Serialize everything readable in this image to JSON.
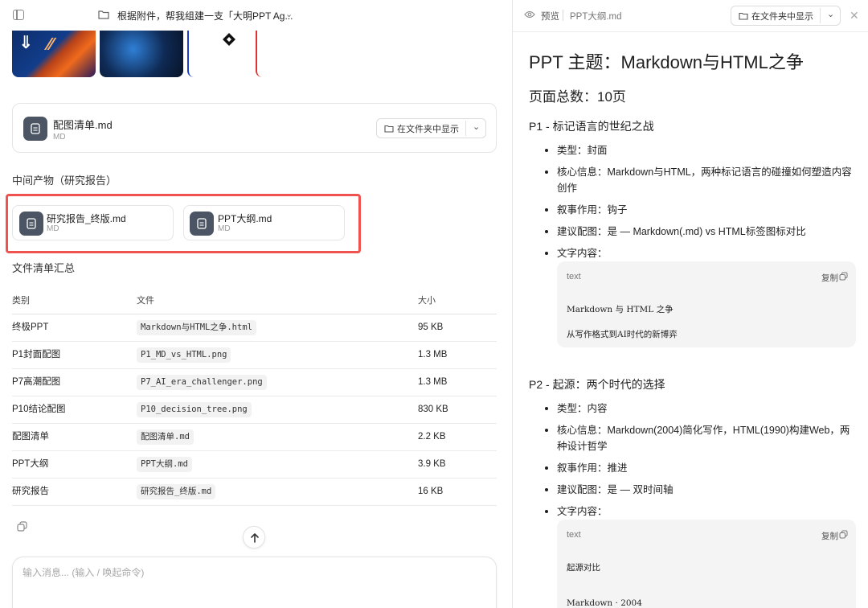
{
  "conversation": {
    "title": "根据附件，帮我组建一支「大明PPT Ag..."
  },
  "left": {
    "config_card": {
      "name": "配图清单.md",
      "ext": "MD",
      "show_in_folder": "在文件夹中显示"
    },
    "intermediate_heading": "中间产物（研究报告）",
    "intermediate_files": [
      {
        "name": "研究报告_终版.md",
        "ext": "MD"
      },
      {
        "name": "PPT大纲.md",
        "ext": "MD"
      }
    ],
    "summary_heading": "文件清单汇总",
    "table": {
      "headers": [
        "类别",
        "文件",
        "大小"
      ],
      "rows": [
        {
          "category": "终极PPT",
          "file": "Markdown与HTML之争.html",
          "size": "95 KB"
        },
        {
          "category": "P1封面配图",
          "file": "P1_MD_vs_HTML.png",
          "size": "1.3 MB"
        },
        {
          "category": "P7高潮配图",
          "file": "P7_AI_era_challenger.png",
          "size": "1.3 MB"
        },
        {
          "category": "P10结论配图",
          "file": "P10_decision_tree.png",
          "size": "830 KB"
        },
        {
          "category": "配图清单",
          "file": "配图清单.md",
          "size": "2.2 KB"
        },
        {
          "category": "PPT大纲",
          "file": "PPT大纲.md",
          "size": "3.9 KB"
        },
        {
          "category": "研究报告",
          "file": "研究报告_终版.md",
          "size": "16 KB"
        }
      ]
    },
    "input_placeholder": "输入消息... (输入 / 唤起命令)"
  },
  "preview": {
    "label": "预览",
    "file": "PPT大纲.md",
    "show_in_folder": "在文件夹中显示",
    "h1": "PPT 主题：Markdown与HTML之争",
    "h2": "页面总数：10页",
    "p1": {
      "title": "P1 - 标记语言的世纪之战",
      "bullets": [
        "类型：封面",
        "核心信息：Markdown与HTML，两种标记语言的碰撞如何塑造内容创作",
        "叙事作用：钩子",
        "建议配图：是 — Markdown(.md) vs HTML标签图标对比",
        "文字内容："
      ],
      "code": {
        "lang": "text",
        "copy": "复制",
        "lines": [
          "Markdown 与 HTML 之争",
          "从写作格式到AI时代的新博弈"
        ]
      }
    },
    "p2": {
      "title": "P2 - 起源：两个时代的选择",
      "bullets": [
        "类型：内容",
        "核心信息：Markdown(2004)简化写作，HTML(1990)构建Web，两种设计哲学",
        "叙事作用：推进",
        "建议配图：是 — 双时间轴",
        "文字内容："
      ],
      "code": {
        "lang": "text",
        "copy": "复制",
        "lines": [
          "起源对比",
          "Markdown · 2004"
        ]
      }
    }
  }
}
